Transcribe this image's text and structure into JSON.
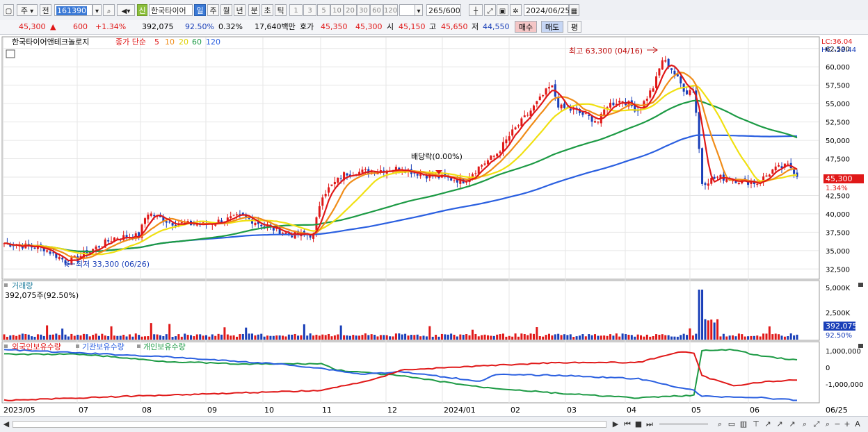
{
  "toolbar": {
    "mode_label": "주",
    "prev_label": "전",
    "code": "161390",
    "new_badge": "신",
    "stock_name": "한국타이어",
    "periods": [
      "일",
      "주",
      "월",
      "년",
      "분",
      "초",
      "틱"
    ],
    "active_period": "일",
    "intervals": [
      "1",
      "3",
      "5",
      "10",
      "20",
      "30",
      "60",
      "120"
    ],
    "bar_count": "265",
    "bar_total": "/600",
    "date": "2024/06/25"
  },
  "quote": {
    "price": "45,300",
    "up_mark": "▲",
    "change": "600",
    "change_pct": "+1.34%",
    "volume": "392,075",
    "vol_ratio": "92.50%",
    "turnover_pct": "0.32%",
    "amount": "17,640백만",
    "bid_label": "호가",
    "bid1": "45,350",
    "bid2": "45,300",
    "open_label": "시",
    "open": "45,150",
    "high_label": "고",
    "high": "45,650",
    "low_label": "저",
    "low": "44,550",
    "buy_label": "매수",
    "sell_label": "매도",
    "eval_label": "평"
  },
  "price_panel": {
    "title": "한국타이어앤테크놀로지",
    "ma_label": "종가 단순",
    "ma_periods": [
      "5",
      "10",
      "20",
      "60",
      "120"
    ],
    "ma_colors": [
      "#e01818",
      "#f08c18",
      "#f0e010",
      "#1c9a44",
      "#2a5fe0"
    ],
    "lc_label": "LC:36.04",
    "hc_label": "HC:-28.44",
    "high_annot": "최고 63,300 (04/16)",
    "low_annot": "최저 33,300 (06/26)",
    "dividend_annot": "배당락(0.00%)",
    "current_price_tag": "45,300",
    "current_pct_tag": "1.34%",
    "yaxis": [
      "62,500",
      "60,000",
      "57,500",
      "55,000",
      "52,500",
      "50,000",
      "47,500",
      "45,000",
      "42,500",
      "40,000",
      "37,500",
      "35,000",
      "32,500"
    ]
  },
  "volume_panel": {
    "title": "거래량",
    "value_label": "392,075주(92.50%)",
    "yaxis": [
      "5,000K",
      "2,500K"
    ],
    "current_tag": "392,075",
    "current_pct": "92.50%"
  },
  "holding_panel": {
    "legend": [
      "외국인보유수량",
      "기관보유수량",
      "개인보유수량"
    ],
    "legend_colors": [
      "#e01818",
      "#2a5fe0",
      "#1c9a44"
    ],
    "yaxis": [
      "1,000,000",
      "0",
      "-1,000,000"
    ]
  },
  "xaxis": {
    "labels": [
      "2023/05",
      "07",
      "08",
      "09",
      "10",
      "11",
      "12",
      "2024/01",
      "02",
      "03",
      "04",
      "05",
      "06"
    ],
    "end_label": "06/25"
  },
  "chart_data": {
    "type": "line",
    "title": "",
    "xlabel": "",
    "ylabel": "",
    "ylim": [
      31300,
      63800
    ],
    "categories": [
      "2023/05",
      "07",
      "08",
      "09",
      "10",
      "11",
      "12",
      "2024/01",
      "02",
      "03",
      "04",
      "05",
      "06"
    ],
    "series": [
      {
        "name": "5",
        "values": [
          36000,
          34000,
          35500,
          38800,
          38700,
          37600,
          45500,
          45300,
          45000,
          57500,
          61500,
          42500,
          45300
        ]
      },
      {
        "name": "120",
        "values": [
          34800,
          34900,
          35600,
          36500,
          37300,
          38400,
          41000,
          42800,
          45300,
          47800,
          49500,
          50300,
          50200
        ]
      }
    ]
  }
}
